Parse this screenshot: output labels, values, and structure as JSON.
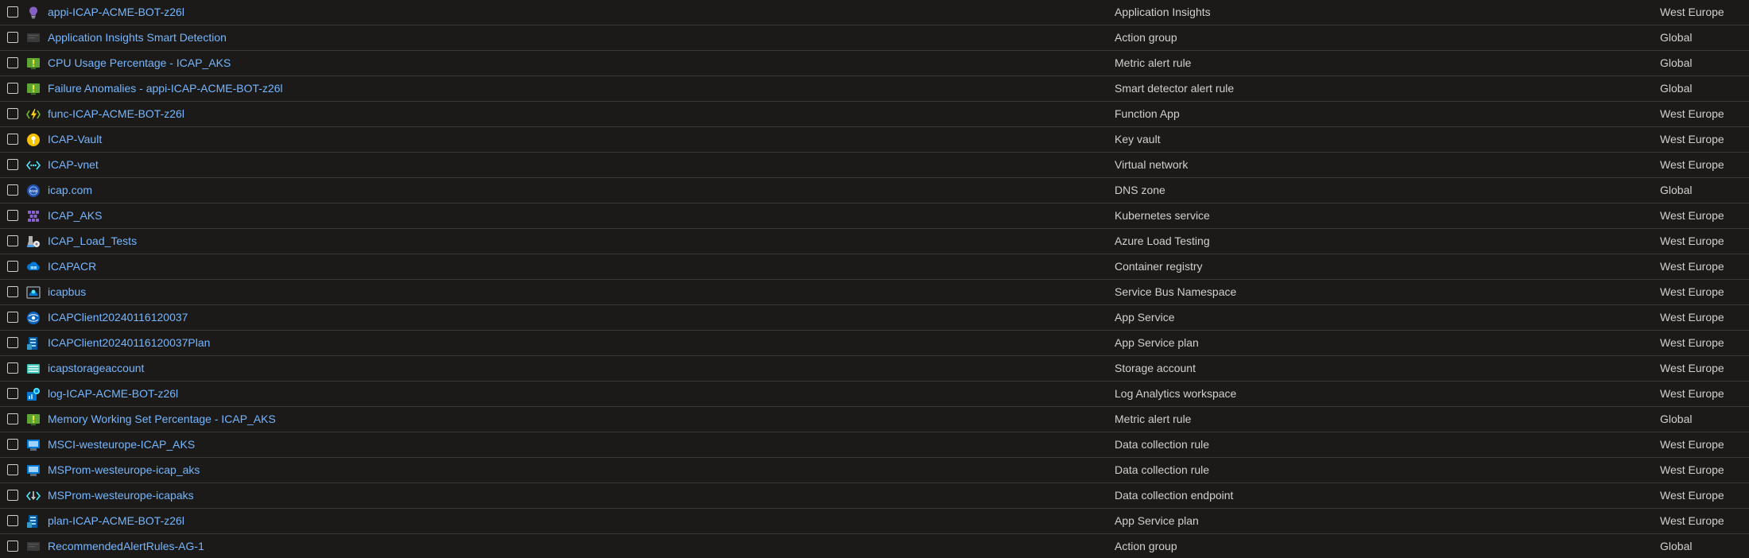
{
  "resources": [
    {
      "name": "appi-ICAP-ACME-BOT-z26l",
      "type": "Application Insights",
      "location": "West Europe",
      "icon": "application-insights-icon"
    },
    {
      "name": "Application Insights Smart Detection",
      "type": "Action group",
      "location": "Global",
      "icon": "action-group-icon"
    },
    {
      "name": "CPU Usage Percentage - ICAP_AKS",
      "type": "Metric alert rule",
      "location": "Global",
      "icon": "alert-rule-icon"
    },
    {
      "name": "Failure Anomalies - appi-ICAP-ACME-BOT-z26l",
      "type": "Smart detector alert rule",
      "location": "Global",
      "icon": "alert-rule-icon"
    },
    {
      "name": "func-ICAP-ACME-BOT-z26l",
      "type": "Function App",
      "location": "West Europe",
      "icon": "function-app-icon"
    },
    {
      "name": "ICAP-Vault",
      "type": "Key vault",
      "location": "West Europe",
      "icon": "key-vault-icon"
    },
    {
      "name": "ICAP-vnet",
      "type": "Virtual network",
      "location": "West Europe",
      "icon": "virtual-network-icon"
    },
    {
      "name": "icap.com",
      "type": "DNS zone",
      "location": "Global",
      "icon": "dns-zone-icon"
    },
    {
      "name": "ICAP_AKS",
      "type": "Kubernetes service",
      "location": "West Europe",
      "icon": "kubernetes-icon"
    },
    {
      "name": "ICAP_Load_Tests",
      "type": "Azure Load Testing",
      "location": "West Europe",
      "icon": "load-testing-icon"
    },
    {
      "name": "ICAPACR",
      "type": "Container registry",
      "location": "West Europe",
      "icon": "container-registry-icon"
    },
    {
      "name": "icapbus",
      "type": "Service Bus Namespace",
      "location": "West Europe",
      "icon": "service-bus-icon"
    },
    {
      "name": "ICAPClient20240116120037",
      "type": "App Service",
      "location": "West Europe",
      "icon": "app-service-icon"
    },
    {
      "name": "ICAPClient20240116120037Plan",
      "type": "App Service plan",
      "location": "West Europe",
      "icon": "app-service-plan-icon"
    },
    {
      "name": "icapstorageaccount",
      "type": "Storage account",
      "location": "West Europe",
      "icon": "storage-account-icon"
    },
    {
      "name": "log-ICAP-ACME-BOT-z26l",
      "type": "Log Analytics workspace",
      "location": "West Europe",
      "icon": "log-analytics-icon"
    },
    {
      "name": "Memory Working Set Percentage - ICAP_AKS",
      "type": "Metric alert rule",
      "location": "Global",
      "icon": "alert-rule-icon"
    },
    {
      "name": "MSCI-westeurope-ICAP_AKS",
      "type": "Data collection rule",
      "location": "West Europe",
      "icon": "data-collection-rule-icon"
    },
    {
      "name": "MSProm-westeurope-icap_aks",
      "type": "Data collection rule",
      "location": "West Europe",
      "icon": "data-collection-rule-icon"
    },
    {
      "name": "MSProm-westeurope-icapaks",
      "type": "Data collection endpoint",
      "location": "West Europe",
      "icon": "data-collection-endpoint-icon"
    },
    {
      "name": "plan-ICAP-ACME-BOT-z26l",
      "type": "App Service plan",
      "location": "West Europe",
      "icon": "app-service-plan-icon"
    },
    {
      "name": "RecommendedAlertRules-AG-1",
      "type": "Action group",
      "location": "Global",
      "icon": "action-group-icon"
    }
  ],
  "colors": {
    "background": "#1b1a19",
    "link": "#75b6ff",
    "text": "#d0d0d0",
    "divider": "#3a3a3a"
  }
}
